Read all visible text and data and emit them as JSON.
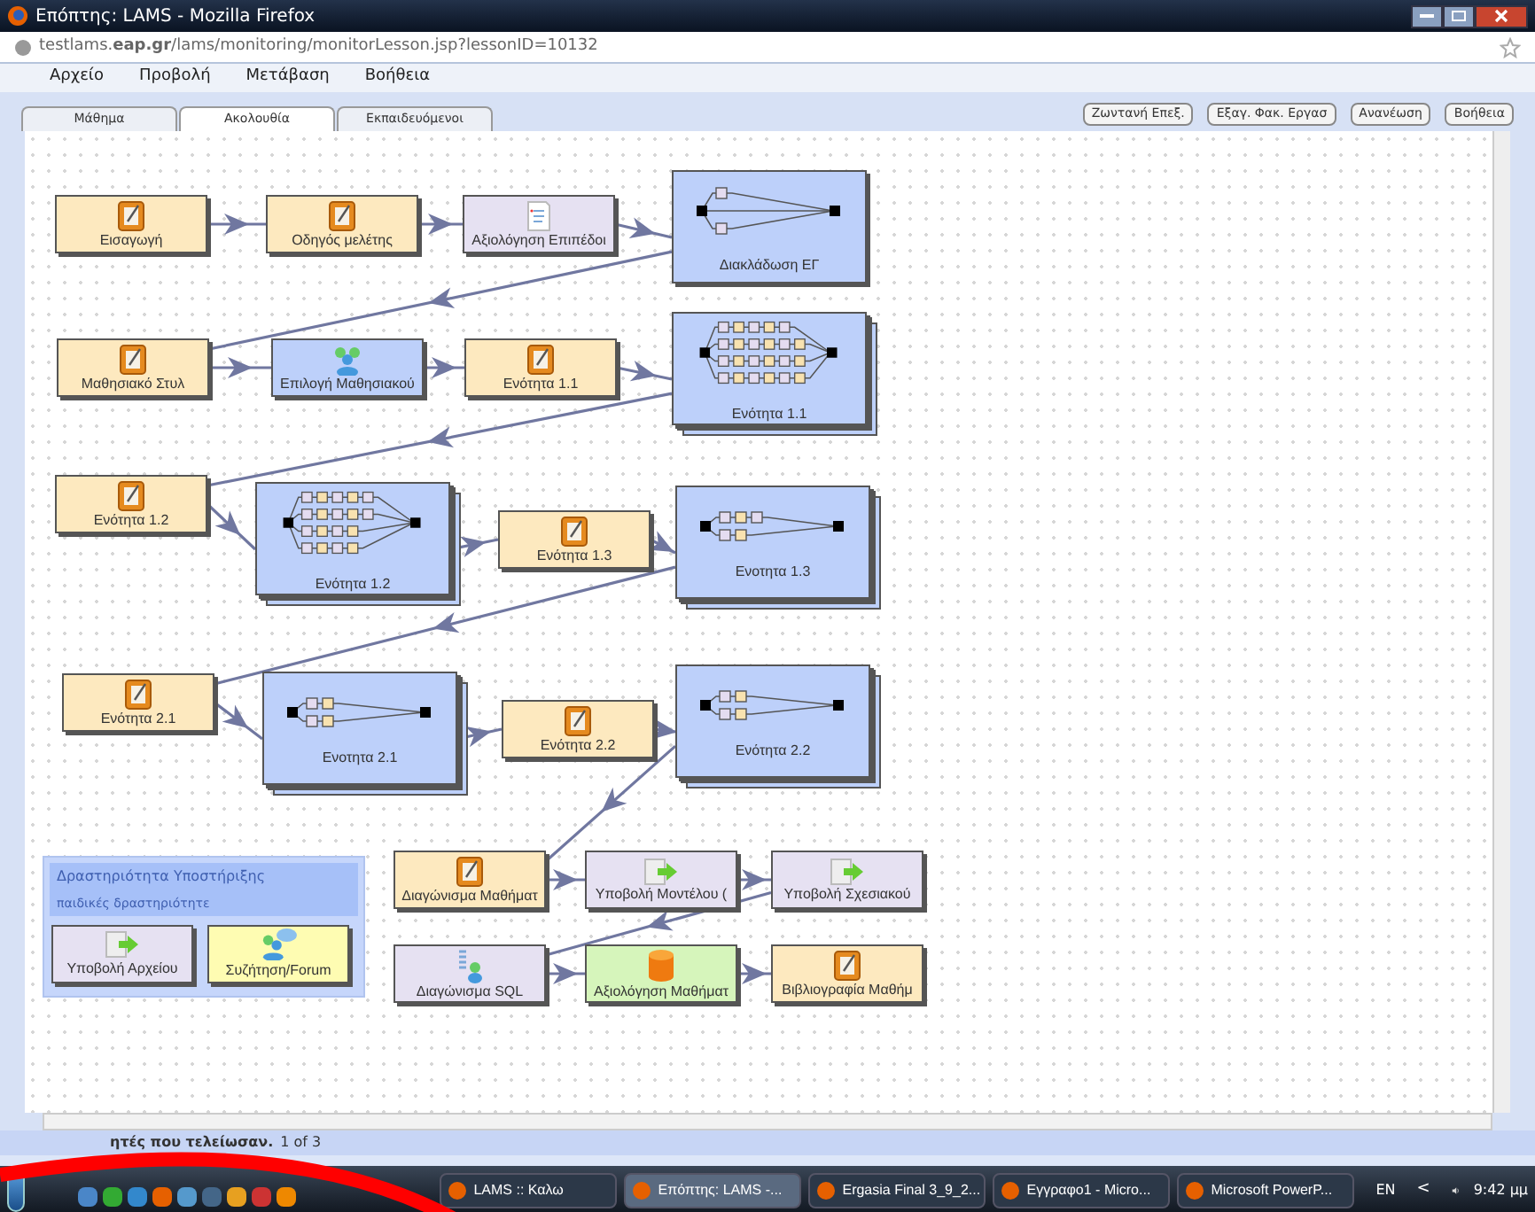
{
  "window": {
    "title": "Επόπτης: LAMS - Mozilla Firefox"
  },
  "address_bar": {
    "url": "testlams.**eap.gr**/lams/monitoring/monitorLesson.jsp?lessonID=10132"
  },
  "menu": [
    "Αρχείο",
    "Προβολή",
    "Μετάβαση",
    "Βοήθεια"
  ],
  "tabs": [
    {
      "label": "Μάθημα",
      "selected": false
    },
    {
      "label": "Ακολουθία",
      "selected": true
    },
    {
      "label": "Εκπαιδευόμενοι",
      "selected": false
    }
  ],
  "toolbar_buttons": [
    "Ζωντανή Επεξ.",
    "Εξαγ. Φακ. Εργασ",
    "Ανανέωση",
    "Βοήθεια"
  ],
  "nodes": [
    {
      "label": "Εισαγωγή",
      "kind": "notebook",
      "color": "#fde9bf"
    },
    {
      "label": "Οδηγός μελέτης",
      "kind": "notebook",
      "color": "#fde9bf"
    },
    {
      "label": "Αξιολόγηση Επιπέδοι",
      "kind": "survey",
      "color": "#e6e1f2"
    },
    {
      "label": "Διακλάδωση ΕΓ",
      "kind": "branch",
      "color": "#bdd0fa"
    },
    {
      "label": "Μαθησιακό Στυλ",
      "kind": "notebook",
      "color": "#fde9bf"
    },
    {
      "label": "Επιλογή Μαθησιακού",
      "kind": "group",
      "color": "#bdd0fa"
    },
    {
      "label": "Ενότητα 1.1",
      "kind": "notebook",
      "color": "#fde9bf"
    },
    {
      "label": "Ενότητα 1.1",
      "kind": "sequences",
      "color": "#bdd0fa"
    },
    {
      "label": "Ενότητα 1.2",
      "kind": "notebook",
      "color": "#fde9bf"
    },
    {
      "label": "Ενότητα 1.2",
      "kind": "sequences",
      "color": "#bdd0fa"
    },
    {
      "label": "Ενότητα 1.3",
      "kind": "notebook",
      "color": "#fde9bf"
    },
    {
      "label": "Ενοτητα 1.3",
      "kind": "sequences",
      "color": "#bdd0fa"
    },
    {
      "label": "Ενότητα 2.1",
      "kind": "notebook",
      "color": "#fde9bf"
    },
    {
      "label": "Ενοτητα 2.1",
      "kind": "sequences",
      "color": "#bdd0fa"
    },
    {
      "label": "Ενότητα 2.2",
      "kind": "notebook",
      "color": "#fde9bf"
    },
    {
      "label": "Ενότητα 2.2",
      "kind": "sequences",
      "color": "#bdd0fa"
    },
    {
      "label": "Διαγώνισμα Μαθήματ",
      "kind": "notebook",
      "color": "#fde9bf"
    },
    {
      "label": "Υποβολή Μοντέλου (",
      "kind": "submit",
      "color": "#e6e1f2"
    },
    {
      "label": "Υποβολή Σχεσιακού",
      "kind": "submit",
      "color": "#e6e1f2"
    },
    {
      "label": "Διαγώνισμα SQL",
      "kind": "sql",
      "color": "#e6e1f2"
    },
    {
      "label": "Αξιολόγηση Μαθήματ",
      "kind": "database",
      "color": "#d6f5bb"
    },
    {
      "label": "Βιβλιογραφία Μαθήμ",
      "kind": "notebook",
      "color": "#fde9bf"
    }
  ],
  "support_panel": {
    "title": "Δραστηριότητα Υποστήριξης",
    "subtitle": "παιδικές δραστηριότητε",
    "items": [
      {
        "label": "Υποβολή Αρχείου",
        "kind": "submit",
        "color": "#e6e1f2"
      },
      {
        "label": "Συζήτηση/Forum",
        "kind": "forum",
        "color": "#fefcb2"
      }
    ]
  },
  "status_bar": {
    "text": "ητές που τελείωσαν.",
    "pages": "1 of 3"
  },
  "taskbar": {
    "tasks": [
      {
        "label": "LAMS :: Καλω",
        "selected": false
      },
      {
        "label": "Επόπτης: LAMS -...",
        "selected": true
      },
      {
        "label": "Ergasia Final 3_9_2...",
        "selected": false
      },
      {
        "label": "Εγγραφο1 - Micro...",
        "selected": false
      },
      {
        "label": "Microsoft PowerP...",
        "selected": false
      }
    ],
    "language": "EN",
    "chevron": "<",
    "clock": "9:42 μμ"
  }
}
